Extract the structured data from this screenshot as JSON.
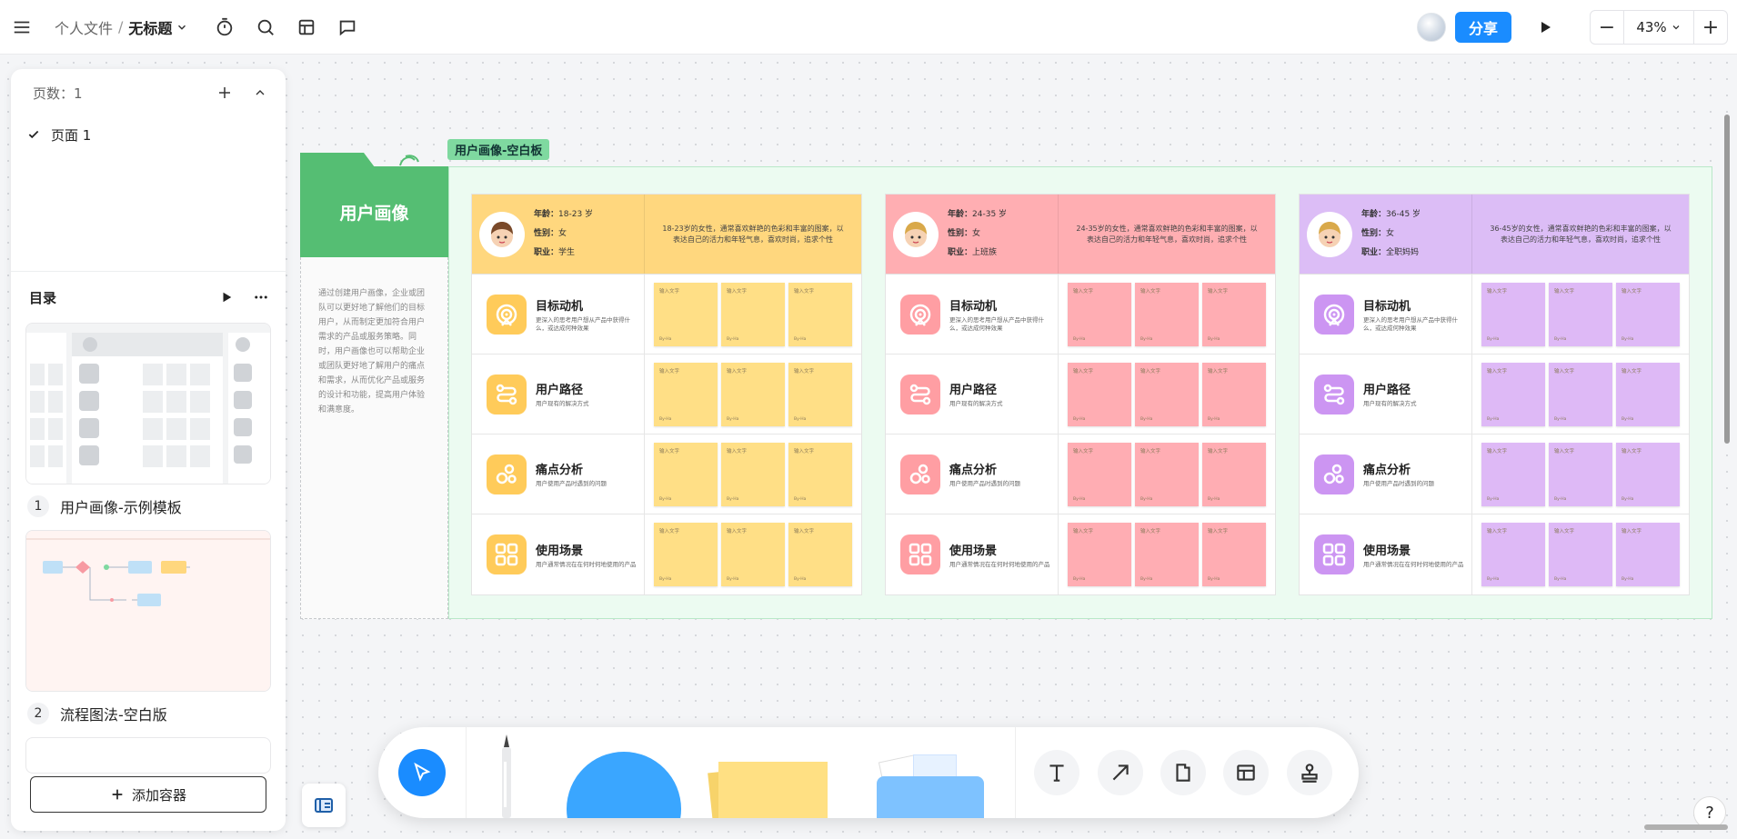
{
  "topbar": {
    "crumb_folder": "个人文件",
    "crumb_sep": "/",
    "title": "无标题",
    "share_label": "分享",
    "zoom_value": "43%"
  },
  "panel": {
    "pages_count": "页数：1",
    "page_item": "页面 1",
    "toc_title": "目录",
    "templates": [
      {
        "num": "1",
        "label": "用户画像-示例模板"
      },
      {
        "num": "2",
        "label": "流程图法-空白版"
      }
    ],
    "add_container": "添加容器"
  },
  "board": {
    "frame_label": "用户画像-空白板",
    "side_title": "用户画像",
    "side_text": "通过创建用户画像，企业或团队可以更好地了解他们的目标用户，从而制定更加符合用户需求的产品或服务策略。同时，用户画像也可以帮助企业或团队更好地了解用户的痛点和需求，从而优化产品或服务的设计和功能，提高用户体验和满意度。",
    "meta_labels": {
      "age": "年龄：",
      "gender": "性别：",
      "job": "职业："
    },
    "note_placeholder": "输入文字",
    "note_footer": "By-Ha",
    "rows": [
      {
        "title": "目标动机",
        "sub": "更深入的思考用户想从产品中获得什么，或达成何种效果",
        "icon": "target-icon"
      },
      {
        "title": "用户路径",
        "sub": "用户现有的解决方式",
        "icon": "path-icon"
      },
      {
        "title": "痛点分析",
        "sub": "用户使用产品时遇到的问题",
        "icon": "bubbles-icon"
      },
      {
        "title": "使用场景",
        "sub": "用户通常情况在在何时何地使用的产品",
        "icon": "grid-icon"
      }
    ],
    "personas": [
      {
        "age": "18-23 岁",
        "gender": "女",
        "job": "学生",
        "desc": "18-23岁的女性，通常喜欢鲜艳的色彩和丰富的图案，以表达自己的活力和年轻气息，喜欢时尚，追求个性",
        "color": "#ffd77e",
        "note": "#ffdf86",
        "icon": "#ffcb5a"
      },
      {
        "age": "24-35 岁",
        "gender": "女",
        "job": "上班族",
        "desc": "24-35岁的女性，通常喜欢鲜艳的色彩和丰富的图案，以表达自己的活力和年轻气息，喜欢时尚，追求个性",
        "color": "#ffaeb2",
        "note": "#ffadb3",
        "icon": "#ff9ea3"
      },
      {
        "age": "36-45 岁",
        "gender": "女",
        "job": "全职妈妈",
        "desc": "36-45岁的女性，通常喜欢鲜艳的色彩和丰富的图案，以表达自己的活力和年轻气息，喜欢时尚，追求个性",
        "color": "#dcbdf6",
        "note": "#deb9f6",
        "icon": "#cc95f2"
      }
    ]
  },
  "colors": {
    "accent": "#1a8cff",
    "board_green": "#55be73"
  }
}
